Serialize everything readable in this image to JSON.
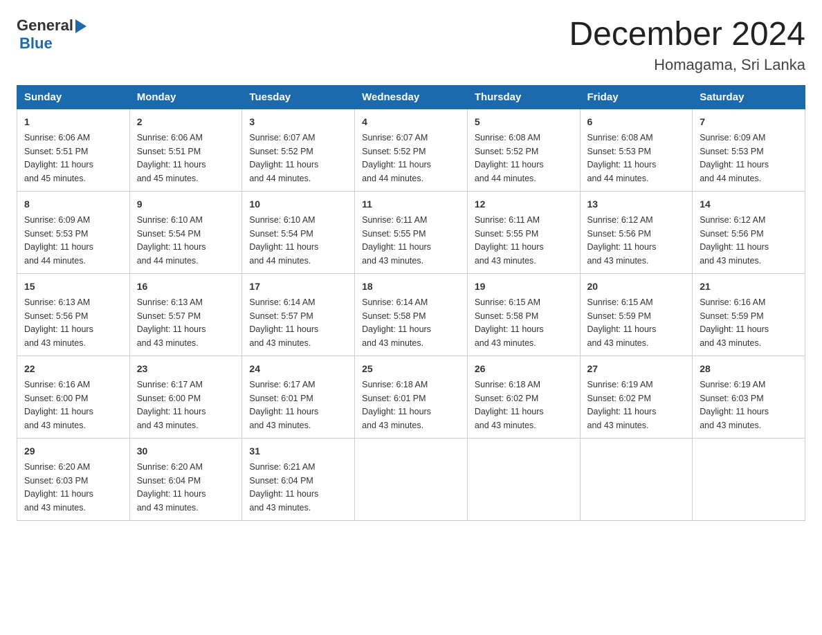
{
  "header": {
    "title": "December 2024",
    "subtitle": "Homagama, Sri Lanka",
    "logo_general": "General",
    "logo_blue": "Blue"
  },
  "days_of_week": [
    "Sunday",
    "Monday",
    "Tuesday",
    "Wednesday",
    "Thursday",
    "Friday",
    "Saturday"
  ],
  "weeks": [
    [
      {
        "day": "1",
        "sunrise": "6:06 AM",
        "sunset": "5:51 PM",
        "daylight": "11 hours and 45 minutes."
      },
      {
        "day": "2",
        "sunrise": "6:06 AM",
        "sunset": "5:51 PM",
        "daylight": "11 hours and 45 minutes."
      },
      {
        "day": "3",
        "sunrise": "6:07 AM",
        "sunset": "5:52 PM",
        "daylight": "11 hours and 44 minutes."
      },
      {
        "day": "4",
        "sunrise": "6:07 AM",
        "sunset": "5:52 PM",
        "daylight": "11 hours and 44 minutes."
      },
      {
        "day": "5",
        "sunrise": "6:08 AM",
        "sunset": "5:52 PM",
        "daylight": "11 hours and 44 minutes."
      },
      {
        "day": "6",
        "sunrise": "6:08 AM",
        "sunset": "5:53 PM",
        "daylight": "11 hours and 44 minutes."
      },
      {
        "day": "7",
        "sunrise": "6:09 AM",
        "sunset": "5:53 PM",
        "daylight": "11 hours and 44 minutes."
      }
    ],
    [
      {
        "day": "8",
        "sunrise": "6:09 AM",
        "sunset": "5:53 PM",
        "daylight": "11 hours and 44 minutes."
      },
      {
        "day": "9",
        "sunrise": "6:10 AM",
        "sunset": "5:54 PM",
        "daylight": "11 hours and 44 minutes."
      },
      {
        "day": "10",
        "sunrise": "6:10 AM",
        "sunset": "5:54 PM",
        "daylight": "11 hours and 44 minutes."
      },
      {
        "day": "11",
        "sunrise": "6:11 AM",
        "sunset": "5:55 PM",
        "daylight": "11 hours and 43 minutes."
      },
      {
        "day": "12",
        "sunrise": "6:11 AM",
        "sunset": "5:55 PM",
        "daylight": "11 hours and 43 minutes."
      },
      {
        "day": "13",
        "sunrise": "6:12 AM",
        "sunset": "5:56 PM",
        "daylight": "11 hours and 43 minutes."
      },
      {
        "day": "14",
        "sunrise": "6:12 AM",
        "sunset": "5:56 PM",
        "daylight": "11 hours and 43 minutes."
      }
    ],
    [
      {
        "day": "15",
        "sunrise": "6:13 AM",
        "sunset": "5:56 PM",
        "daylight": "11 hours and 43 minutes."
      },
      {
        "day": "16",
        "sunrise": "6:13 AM",
        "sunset": "5:57 PM",
        "daylight": "11 hours and 43 minutes."
      },
      {
        "day": "17",
        "sunrise": "6:14 AM",
        "sunset": "5:57 PM",
        "daylight": "11 hours and 43 minutes."
      },
      {
        "day": "18",
        "sunrise": "6:14 AM",
        "sunset": "5:58 PM",
        "daylight": "11 hours and 43 minutes."
      },
      {
        "day": "19",
        "sunrise": "6:15 AM",
        "sunset": "5:58 PM",
        "daylight": "11 hours and 43 minutes."
      },
      {
        "day": "20",
        "sunrise": "6:15 AM",
        "sunset": "5:59 PM",
        "daylight": "11 hours and 43 minutes."
      },
      {
        "day": "21",
        "sunrise": "6:16 AM",
        "sunset": "5:59 PM",
        "daylight": "11 hours and 43 minutes."
      }
    ],
    [
      {
        "day": "22",
        "sunrise": "6:16 AM",
        "sunset": "6:00 PM",
        "daylight": "11 hours and 43 minutes."
      },
      {
        "day": "23",
        "sunrise": "6:17 AM",
        "sunset": "6:00 PM",
        "daylight": "11 hours and 43 minutes."
      },
      {
        "day": "24",
        "sunrise": "6:17 AM",
        "sunset": "6:01 PM",
        "daylight": "11 hours and 43 minutes."
      },
      {
        "day": "25",
        "sunrise": "6:18 AM",
        "sunset": "6:01 PM",
        "daylight": "11 hours and 43 minutes."
      },
      {
        "day": "26",
        "sunrise": "6:18 AM",
        "sunset": "6:02 PM",
        "daylight": "11 hours and 43 minutes."
      },
      {
        "day": "27",
        "sunrise": "6:19 AM",
        "sunset": "6:02 PM",
        "daylight": "11 hours and 43 minutes."
      },
      {
        "day": "28",
        "sunrise": "6:19 AM",
        "sunset": "6:03 PM",
        "daylight": "11 hours and 43 minutes."
      }
    ],
    [
      {
        "day": "29",
        "sunrise": "6:20 AM",
        "sunset": "6:03 PM",
        "daylight": "11 hours and 43 minutes."
      },
      {
        "day": "30",
        "sunrise": "6:20 AM",
        "sunset": "6:04 PM",
        "daylight": "11 hours and 43 minutes."
      },
      {
        "day": "31",
        "sunrise": "6:21 AM",
        "sunset": "6:04 PM",
        "daylight": "11 hours and 43 minutes."
      },
      null,
      null,
      null,
      null
    ]
  ],
  "labels": {
    "sunrise": "Sunrise:",
    "sunset": "Sunset:",
    "daylight": "Daylight:"
  }
}
